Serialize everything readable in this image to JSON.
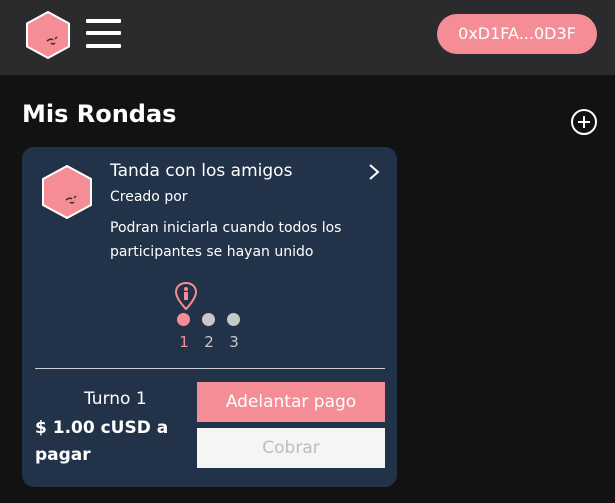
{
  "header": {
    "wallet_address": "0xD1FA...0D3F"
  },
  "page": {
    "title": "Mis Rondas"
  },
  "round_card": {
    "title": "Tanda con los amigos",
    "created_by": "Creado por",
    "description": "Podran iniciarla cuando todos los participantes se hayan unido",
    "participants": [
      {
        "number": "1",
        "active": true
      },
      {
        "number": "2",
        "active": false
      },
      {
        "number": "3",
        "active": false
      }
    ],
    "turn_label": "Turno 1",
    "amount_label": "$ 1.00 cUSD a pagar",
    "advance_button": "Adelantar pago",
    "collect_button": "Cobrar"
  },
  "colors": {
    "accent": "#f58d96",
    "card_bg": "#223248",
    "header_bg": "#2b2b2d",
    "page_bg": "#121212",
    "dot_inactive": "#c8c8c8"
  },
  "icons": {
    "logo": "hexagon-logo-icon",
    "menu": "hamburger-menu-icon",
    "add": "plus-circle-icon",
    "chevron": "chevron-right-icon",
    "marker": "person-marker-icon"
  }
}
